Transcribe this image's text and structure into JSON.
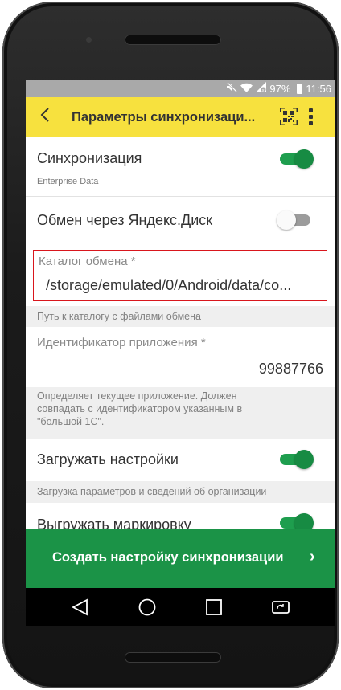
{
  "status_bar": {
    "battery_percent": "97%",
    "time": "11:56",
    "icons": [
      "mute-icon",
      "wifi-icon",
      "signal-icon",
      "battery-icon"
    ]
  },
  "app_bar": {
    "title": "Параметры синхронизаци...",
    "back_icon": "chevron-left-icon",
    "qr_icon": "qr-code-icon",
    "menu_icon": "more-vertical-icon"
  },
  "settings": {
    "sync": {
      "label": "Синхронизация",
      "sub": "Enterprise Data",
      "enabled": true
    },
    "yandex_disk": {
      "label": "Обмен через Яндекс.Диск",
      "enabled": false
    },
    "exchange_catalog": {
      "label": "Каталог обмена *",
      "value": "/storage/emulated/0/Android/data/co...",
      "hint": "Путь к каталогу с файлами обмена"
    },
    "app_id": {
      "label": "Идентификатор приложения *",
      "value": "99887766",
      "hint_line1": "Определяет текущее приложение. Должен",
      "hint_line2": "совпадать с идентификатором указанным в",
      "hint_line3": "\"большой 1С\"."
    },
    "load_settings": {
      "label": "Загружать настройки",
      "enabled": true,
      "hint": "Загрузка параметров и сведений об организации"
    },
    "export_marking": {
      "label": "Выгружать маркировку",
      "enabled": true
    }
  },
  "cta": {
    "label": "Создать настройку синхронизации",
    "arrow": "›"
  },
  "nav_bar": {
    "icons": [
      "back-triangle-icon",
      "home-circle-icon",
      "recents-square-icon",
      "rotate-screen-icon"
    ]
  },
  "colors": {
    "accent_yellow": "#f7e13e",
    "primary_green": "#1b9347",
    "highlight_red": "#d9161d"
  }
}
